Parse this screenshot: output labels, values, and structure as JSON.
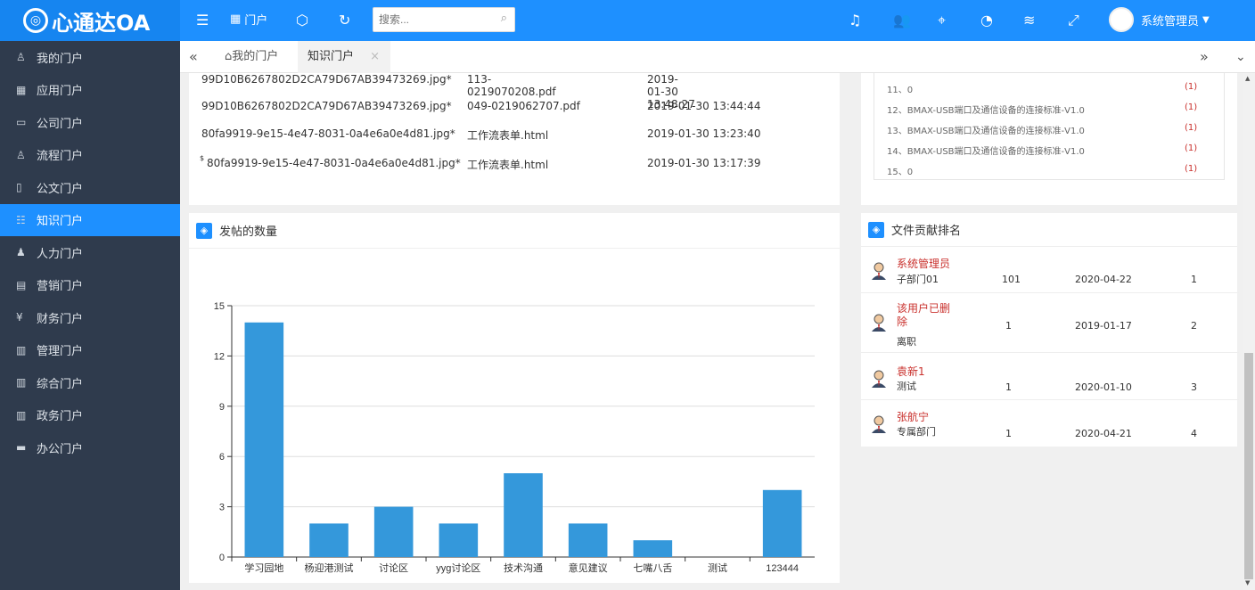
{
  "app": {
    "logo_text": "心通达OA"
  },
  "topbar": {
    "portal_label": "门户",
    "search_placeholder": "搜索...",
    "user_name": "系统管理员"
  },
  "sidebar": {
    "items": [
      {
        "label": "我的门户",
        "icon": "user-icon"
      },
      {
        "label": "应用门户",
        "icon": "apps-icon"
      },
      {
        "label": "公司门户",
        "icon": "company-icon"
      },
      {
        "label": "流程门户",
        "icon": "flow-icon"
      },
      {
        "label": "公文门户",
        "icon": "document-icon"
      },
      {
        "label": "知识门户",
        "icon": "book-icon",
        "active": true
      },
      {
        "label": "人力门户",
        "icon": "people-icon"
      },
      {
        "label": "营销门户",
        "icon": "calendar-icon"
      },
      {
        "label": "财务门户",
        "icon": "yen-icon"
      },
      {
        "label": "管理门户",
        "icon": "grid-icon"
      },
      {
        "label": "综合门户",
        "icon": "library-icon"
      },
      {
        "label": "政务门户",
        "icon": "library-icon"
      },
      {
        "label": "办公门户",
        "icon": "card-icon"
      }
    ]
  },
  "tabs": [
    {
      "label": "我的门户"
    },
    {
      "label": "知识门户",
      "active": true
    }
  ],
  "files": {
    "rows": [
      {
        "name": "99D10B6267802D2CA79D67AB39473269.jpg*",
        "file": "113-0219070208.pdf",
        "time": "2019-01-30 13:48:27"
      },
      {
        "name": "99D10B6267802D2CA79D67AB39473269.jpg*",
        "file": "049-0219062707.pdf",
        "time": "2019-01-30 13:44:44"
      },
      {
        "name": "80fa9919-9e15-4e47-8031-0a4e6a0e4d81.jpg*",
        "file": "工作流表单.html",
        "time": "2019-01-30 13:23:40"
      },
      {
        "name": "80fa9919-9e15-4e47-8031-0a4e6a0e4d81.jpg*",
        "file": "工作流表单.html",
        "time": "2019-01-30 13:17:39",
        "prefix": "$"
      }
    ]
  },
  "list": {
    "rows": [
      {
        "text": "11、0",
        "count": "(1)"
      },
      {
        "text": "12、BMAX-USB端口及通信设备的连接标准-V1.0",
        "count": "(1)"
      },
      {
        "text": "13、BMAX-USB端口及通信设备的连接标准-V1.0",
        "count": "(1)"
      },
      {
        "text": "14、BMAX-USB端口及通信设备的连接标准-V1.0",
        "count": "(1)"
      },
      {
        "text": "15、0",
        "count": "(1)"
      }
    ]
  },
  "chart_panel": {
    "title": "发帖的数量"
  },
  "chart_data": {
    "type": "bar",
    "categories": [
      "学习园地",
      "杨迎港测试",
      "讨论区",
      "yyg讨论区",
      "技术沟通",
      "意见建议",
      "七嘴八舌",
      "测试",
      "123444"
    ],
    "values": [
      14,
      2,
      3,
      2,
      5,
      2,
      1,
      0,
      4
    ],
    "ylim": [
      0,
      15
    ],
    "yticks": [
      0,
      3,
      6,
      9,
      12,
      15
    ],
    "color": "#3498db",
    "grid": true
  },
  "ranking": {
    "title": "文件贡献排名",
    "rows": [
      {
        "name": "系统管理员",
        "dept": "子部门01",
        "count": "101",
        "date": "2020-04-22",
        "rank": "1"
      },
      {
        "name": "该用户已删除",
        "dept": "离职",
        "count": "1",
        "date": "2019-01-17",
        "rank": "2"
      },
      {
        "name": "袁新1",
        "dept": "测试",
        "count": "1",
        "date": "2020-01-10",
        "rank": "3"
      },
      {
        "name": "张航宁",
        "dept": "专属部门",
        "count": "1",
        "date": "2020-04-21",
        "rank": "4"
      }
    ]
  }
}
